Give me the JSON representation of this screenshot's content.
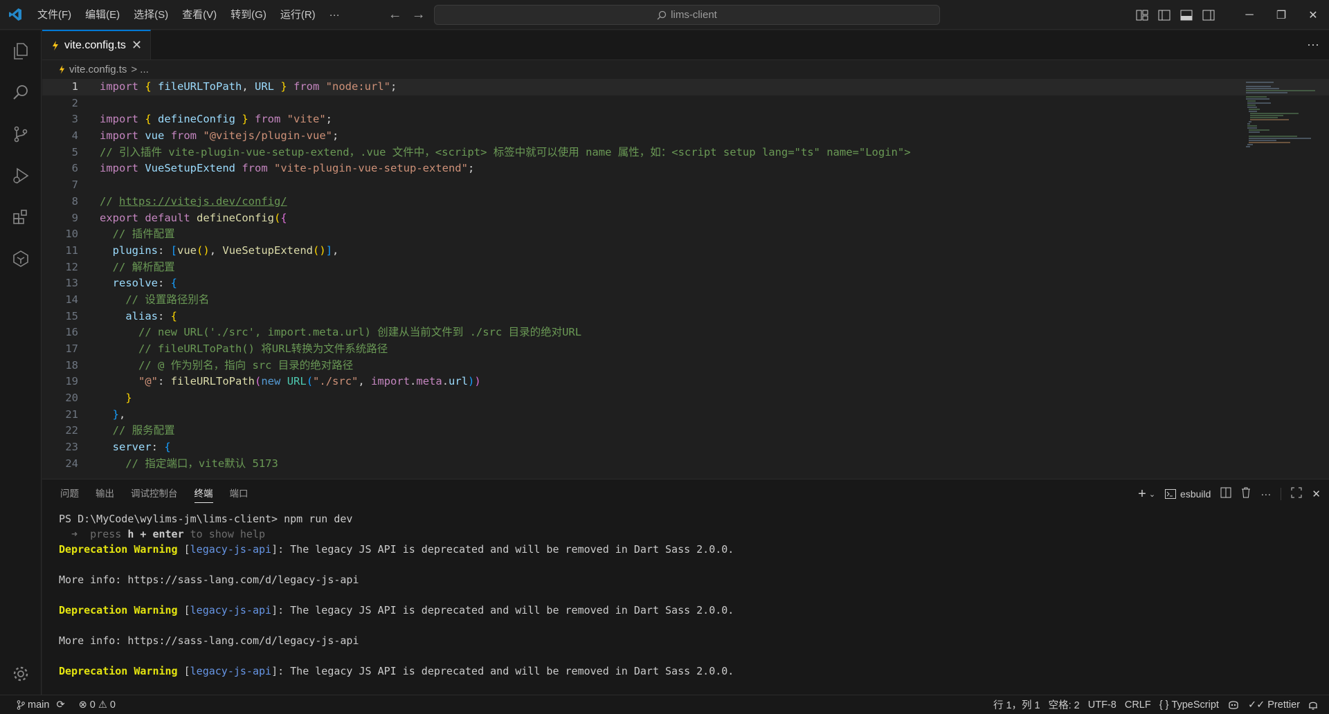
{
  "titlebar": {
    "menu": [
      "文件(F)",
      "编辑(E)",
      "选择(S)",
      "查看(V)",
      "转到(G)",
      "运行(R)",
      "···"
    ],
    "search": "lims-client"
  },
  "editor": {
    "tab_label": "vite.config.ts",
    "breadcrumb_file": "vite.config.ts",
    "breadcrumb_rest": "> ...",
    "line_numbers": [
      "1",
      "2",
      "3",
      "4",
      "5",
      "6",
      "7",
      "8",
      "9",
      "10",
      "11",
      "12",
      "13",
      "14",
      "15",
      "16",
      "17",
      "18",
      "19",
      "20",
      "21",
      "22",
      "23",
      "24"
    ],
    "code": {
      "l1": [
        "import",
        " { ",
        "fileURLToPath",
        ", ",
        "URL",
        " } ",
        "from",
        " ",
        "\"node:url\"",
        ";"
      ],
      "l3": [
        "import",
        " { ",
        "defineConfig",
        " } ",
        "from",
        " ",
        "\"vite\"",
        ";"
      ],
      "l4": [
        "import",
        " ",
        "vue",
        " ",
        "from",
        " ",
        "\"@vitejs/plugin-vue\"",
        ";"
      ],
      "l5": "// 引入插件 vite-plugin-vue-setup-extend，.vue 文件中，<script> 标签中就可以使用 name 属性，如：<script setup lang=\"ts\" name=\"Login\">",
      "l6": [
        "import",
        " ",
        "VueSetupExtend",
        " ",
        "from",
        " ",
        "\"vite-plugin-vue-setup-extend\"",
        ";"
      ],
      "l8_prefix": "// ",
      "l8_link": "https://vitejs.dev/config/",
      "l9": [
        "export",
        " ",
        "default",
        " ",
        "defineConfig",
        "(",
        "{"
      ],
      "l10": "  // 插件配置",
      "l11": [
        "  ",
        "plugins",
        ": ",
        "[",
        "vue",
        "()",
        ", ",
        "VueSetupExtend",
        "()",
        "]",
        ","
      ],
      "l12": "  // 解析配置",
      "l13": [
        "  ",
        "resolve",
        ": ",
        "{"
      ],
      "l14": "    // 设置路径别名",
      "l15": [
        "    ",
        "alias",
        ": ",
        "{"
      ],
      "l16": "      // new URL('./src', import.meta.url) 创建从当前文件到 ./src 目录的绝对URL",
      "l17": "      // fileURLToPath() 将URL转换为文件系统路径",
      "l18": "      // @ 作为别名，指向 src 目录的绝对路径",
      "l19": [
        "      ",
        "\"@\"",
        ": ",
        "fileURLToPath",
        "(",
        "new",
        " ",
        "URL",
        "(",
        "\"./src\"",
        ", ",
        "import",
        ".",
        "meta",
        ".",
        "url",
        ")",
        ")"
      ],
      "l20": [
        "    ",
        "}"
      ],
      "l21": [
        "  ",
        "}",
        ","
      ],
      "l22": "  // 服务配置",
      "l23": [
        "  ",
        "server",
        ": ",
        "{"
      ],
      "l24": "    // 指定端口，vite默认 5173"
    }
  },
  "panel": {
    "tabs": [
      "问题",
      "输出",
      "调试控制台",
      "终端",
      "端口"
    ],
    "terminal_name": "esbuild",
    "prompt": "PS D:\\MyCode\\wylims-jm\\lims-client> ",
    "command": "npm run dev",
    "hint_arrow": "  ➜  ",
    "hint_press": "press ",
    "hint_keys": "h + enter",
    "hint_tail": " to show help",
    "warn_label": "Deprecation Warning",
    "warn_tag": "legacy-js-api",
    "warn_msg": ": The legacy JS API is deprecated and will be removed in Dart Sass 2.0.0.",
    "more_info": "More info: https://sass-lang.com/d/legacy-js-api"
  },
  "statusbar": {
    "branch": "main",
    "errors": "0",
    "warnings": "0",
    "position": "行 1，列 1",
    "spaces": "空格: 2",
    "encoding": "UTF-8",
    "eol": "CRLF",
    "language": "TypeScript",
    "prettier": "Prettier"
  },
  "colors": {
    "accent": "#0078d4",
    "warning": "#e5e510",
    "bg": "#1f1f1f"
  }
}
